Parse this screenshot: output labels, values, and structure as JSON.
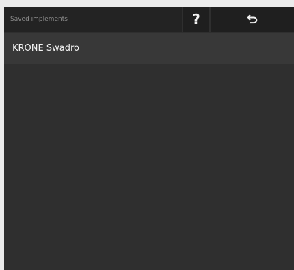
{
  "header": {
    "title": "Saved implements",
    "help_label": "?",
    "back_icon": "back-arrow-icon"
  },
  "implements": [
    {
      "label": "KRONE Swadro"
    }
  ],
  "colors": {
    "page_background": "#ebebeb",
    "screen_background": "#2f2f2f",
    "header_background": "#232323",
    "button_background": "#1f1f1f",
    "list_item_background": "#383838",
    "text_primary": "#f2f2f2",
    "text_muted": "#8e8e8e"
  }
}
